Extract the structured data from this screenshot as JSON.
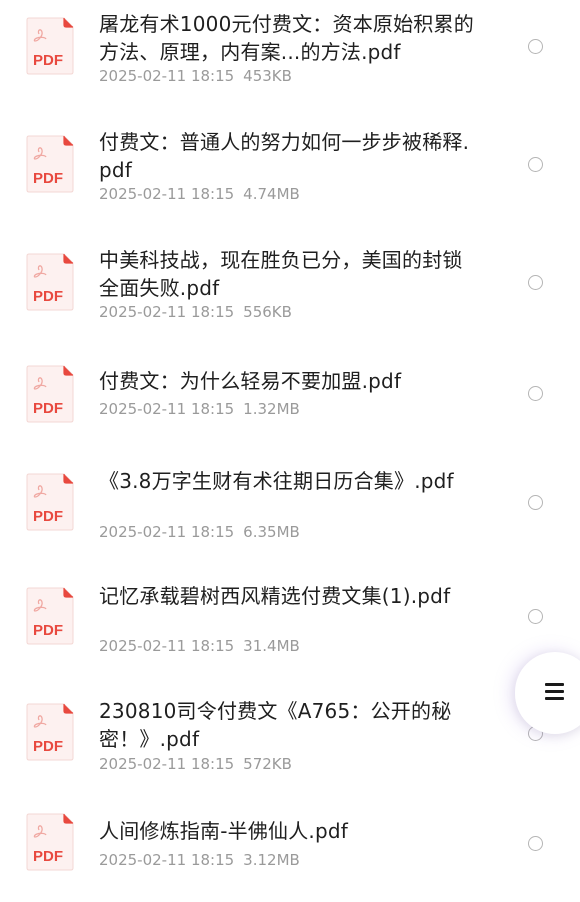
{
  "files": [
    {
      "name": "屠龙有术1000元付费文：资本原始积累的方法、原理，内有案...的方法.pdf",
      "date": "2025-02-11 18:15",
      "size": "453KB",
      "icon": "pdf-file-icon",
      "icon_label": "PDF"
    },
    {
      "name": "付费文：普通人的努力如何一步步被稀释.pdf",
      "date": "2025-02-11 18:15",
      "size": "4.74MB",
      "icon": "pdf-file-icon",
      "icon_label": "PDF"
    },
    {
      "name": "中美科技战，现在胜负已分，美国的封锁全面失败.pdf",
      "date": "2025-02-11 18:15",
      "size": "556KB",
      "icon": "pdf-file-icon",
      "icon_label": "PDF"
    },
    {
      "name": "付费文：为什么轻易不要加盟.pdf",
      "date": "2025-02-11 18:15",
      "size": "1.32MB",
      "icon": "pdf-file-icon",
      "icon_label": "PDF"
    },
    {
      "name": "《3.8万字生财有术往期日历合集》.pdf",
      "date": "2025-02-11 18:15",
      "size": "6.35MB",
      "icon": "pdf-file-icon",
      "icon_label": "PDF"
    },
    {
      "name": "记忆承载碧树西风精选付费文集(1).pdf",
      "date": "2025-02-11 18:15",
      "size": "31.4MB",
      "icon": "pdf-file-icon",
      "icon_label": "PDF"
    },
    {
      "name": "230810司令付费文《A765：公开的秘密！》.pdf",
      "date": "2025-02-11 18:15",
      "size": "572KB",
      "icon": "pdf-file-icon",
      "icon_label": "PDF"
    },
    {
      "name": "人间修炼指南-半佛仙人.pdf",
      "date": "2025-02-11 18:15",
      "size": "3.12MB",
      "icon": "pdf-file-icon",
      "icon_label": "PDF"
    }
  ],
  "menu_button": {
    "icon": "hamburger-menu-icon"
  },
  "colors": {
    "pdf_red": "#e8493f",
    "pdf_paper": "#fdf1f0",
    "name_text": "#1f1f1f",
    "meta_text": "#9a9a9a",
    "radio_border": "#b5b5b5"
  }
}
